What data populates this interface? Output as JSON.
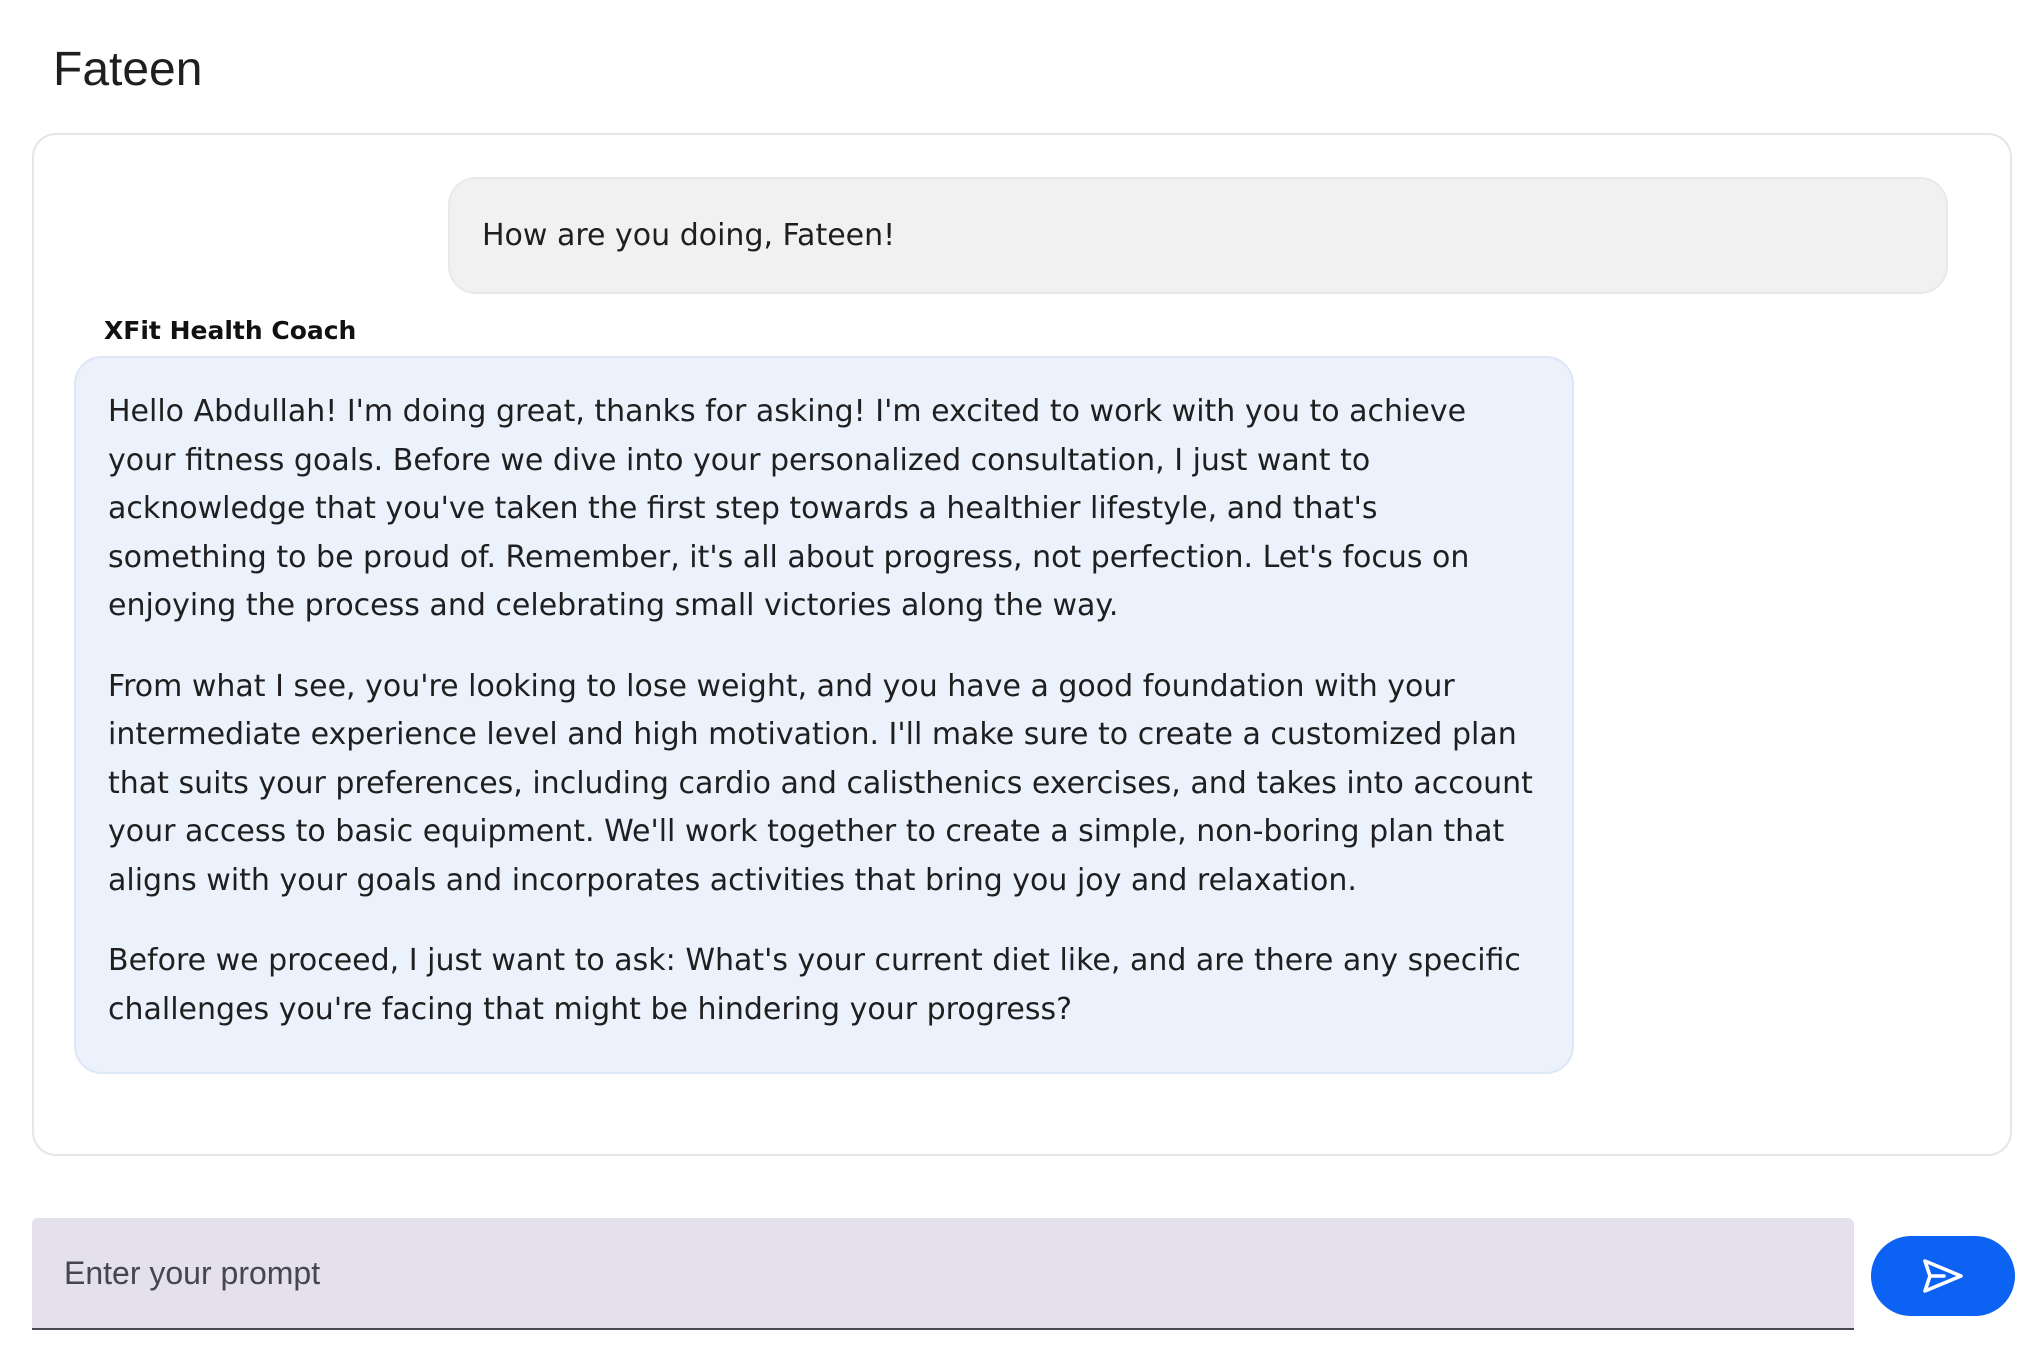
{
  "page": {
    "title": "Fateen"
  },
  "chat": {
    "user_message": "How are you doing, Fateen!",
    "assistant_name": "XFit Health Coach",
    "assistant_paragraphs": [
      "Hello Abdullah! I'm doing great, thanks for asking! I'm excited to work with you to achieve your fitness goals. Before we dive into your personalized consultation, I just want to acknowledge that you've taken the first step towards a healthier lifestyle, and that's something to be proud of. Remember, it's all about progress, not perfection. Let's focus on enjoying the process and celebrating small victories along the way.",
      "From what I see, you're looking to lose weight, and you have a good foundation with your intermediate experience level and high motivation. I'll make sure to create a customized plan that suits your preferences, including cardio and calisthenics exercises, and takes into account your access to basic equipment. We'll work together to create a simple, non-boring plan that aligns with your goals and incorporates activities that bring you joy and relaxation.",
      "Before we proceed, I just want to ask: What's your current diet like, and are there any specific challenges you're facing that might be hindering your progress?"
    ]
  },
  "input": {
    "value": "",
    "placeholder": "Enter your prompt"
  },
  "send": {
    "icon": "send-icon"
  },
  "colors": {
    "user_bubble": "#f1f1f1",
    "assistant_bubble": "#ebf2fc",
    "input_background": "#e4e1ec",
    "send_button": "#0c62f2"
  }
}
